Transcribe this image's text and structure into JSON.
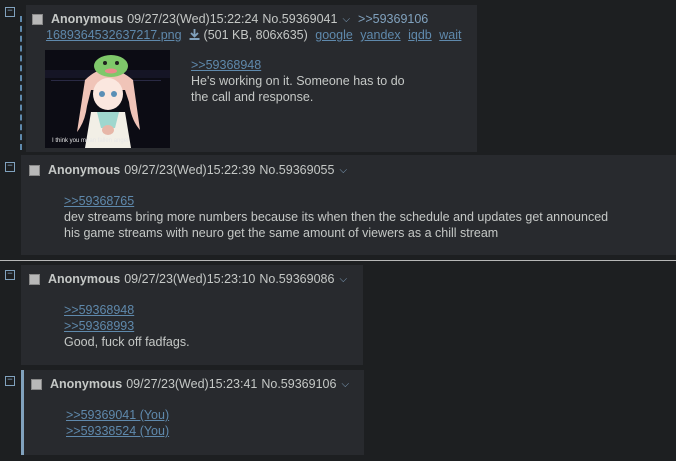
{
  "posts": [
    {
      "name": "Anonymous",
      "datetime": "09/27/23(Wed)15:22:24",
      "number": "No.59369041",
      "backlinks": [
        ">>59369106"
      ],
      "file": {
        "filename": "1689364532637217.png",
        "meta": "(501 KB, 806x635)",
        "search_links": [
          "google",
          "yandex",
          "iqdb",
          "wait"
        ],
        "thumb_caption": "I think you mean fallen angel"
      },
      "quotes": [
        ">>59368948"
      ],
      "lines": [
        "He's working on it. Someone has to do",
        "the call and response."
      ]
    },
    {
      "name": "Anonymous",
      "datetime": "09/27/23(Wed)15:22:39",
      "number": "No.59369055",
      "quotes": [
        ">>59368765"
      ],
      "lines": [
        "dev streams bring more numbers because its when then the schedule and updates get announced",
        "his game streams with neuro get the same amount of viewers as a chill stream"
      ]
    },
    {
      "name": "Anonymous",
      "datetime": "09/27/23(Wed)15:23:10",
      "number": "No.59369086",
      "quotes": [
        ">>59368948",
        ">>59368993"
      ],
      "lines": [
        "Good, fuck off fadfags."
      ]
    },
    {
      "name": "Anonymous",
      "datetime": "09/27/23(Wed)15:23:41",
      "number": "No.59369106",
      "quotes": [
        ">>59369041 (You)",
        ">>59338524 (You)"
      ],
      "lines": []
    }
  ],
  "icons": {
    "hide": "minus-box-icon",
    "menu": "chevron-down-icon",
    "download": "download-icon"
  },
  "colors": {
    "background": "#1d1f21",
    "post_background": "#282a2e",
    "text": "#c5c8c6",
    "link": "#5f89ac",
    "highlight_border": "#81a2be"
  }
}
